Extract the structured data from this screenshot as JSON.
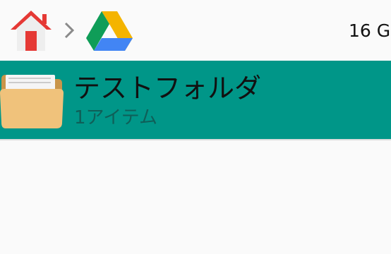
{
  "breadcrumb": {
    "home_icon": "home-icon",
    "separator_icon": "chevron-right-icon",
    "location_icon": "google-drive-icon"
  },
  "storage_text": "16 G",
  "files": [
    {
      "icon": "folder-icon",
      "name": "テストフォルダ",
      "meta": "1アイテム",
      "selected": true
    }
  ],
  "colors": {
    "selection": "#009688",
    "background": "#fafafa"
  }
}
